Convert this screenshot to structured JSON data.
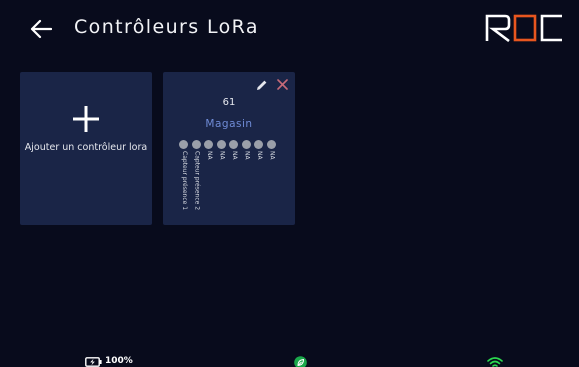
{
  "header": {
    "title": "Contrôleurs LoRa",
    "logo_text": "ROC",
    "logo_colors": {
      "r": "#ffffff",
      "o": "#e8561f",
      "c": "#ffffff"
    }
  },
  "add_card": {
    "label": "Ajouter un contrôleur lora",
    "icon": "plus-icon"
  },
  "controllers": [
    {
      "number": "61",
      "name": "Magasin",
      "sensors": [
        "Capteur présence 1",
        "Capteur présence 2",
        "NA",
        "NA",
        "NA",
        "NA",
        "NA",
        "NA"
      ]
    }
  ],
  "status_bar": {
    "battery": "100%",
    "icons": [
      "battery-charging-icon",
      "leaf-icon",
      "wifi-icon"
    ],
    "leaf_color": "#1aa84a",
    "wifi_color": "#2bd94f"
  },
  "colors": {
    "background": "#080b1c",
    "card": "#1a2547",
    "accent": "#6f8bd6",
    "close": "#c66a78"
  }
}
